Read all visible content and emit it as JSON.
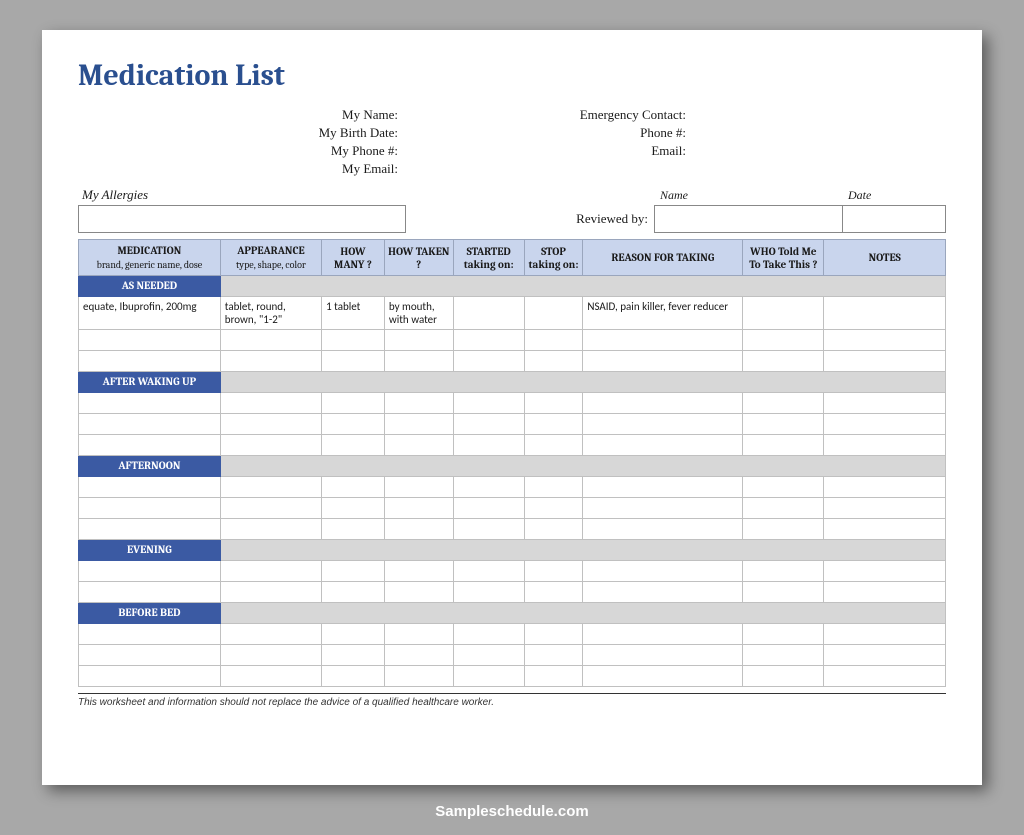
{
  "title": "Medication List",
  "personal": {
    "name_label": "My Name:",
    "birth_label": "My Birth Date:",
    "phone_label": "My Phone #:",
    "email_label": "My Email:"
  },
  "emergency": {
    "contact_label": "Emergency Contact:",
    "phone_label": "Phone #:",
    "email_label": "Email:"
  },
  "allergies_label": "My Allergies",
  "reviewed_label": "Reviewed by:",
  "name_header": "Name",
  "date_header": "Date",
  "columns": {
    "medication": "MEDICATION",
    "medication_sub": "brand, generic name, dose",
    "appearance": "APPEARANCE",
    "appearance_sub": "type, shape, color",
    "howmany": "HOW MANY ?",
    "howtaken": "HOW TAKEN ?",
    "started": "STARTED taking on:",
    "stop": "STOP taking on:",
    "reason": "REASON FOR TAKING",
    "who": "WHO Told Me To Take This ?",
    "notes": "NOTES"
  },
  "sections": {
    "asneeded": "AS NEEDED",
    "waking": "AFTER WAKING UP",
    "afternoon": "AFTERNOON",
    "evening": "EVENING",
    "beforebed": "BEFORE BED"
  },
  "row1": {
    "medication": "equate, Ibuprofin, 200mg",
    "appearance": "tablet, round, brown, \"1-2\"",
    "howmany": "1 tablet",
    "howtaken": "by mouth, with water",
    "started": "",
    "stop": "",
    "reason": "NSAID, pain killer, fever reducer",
    "who": "",
    "notes": ""
  },
  "footnote": "This worksheet and information should not replace the advice of a qualified healthcare worker.",
  "watermark": "Sampleschedule.com"
}
